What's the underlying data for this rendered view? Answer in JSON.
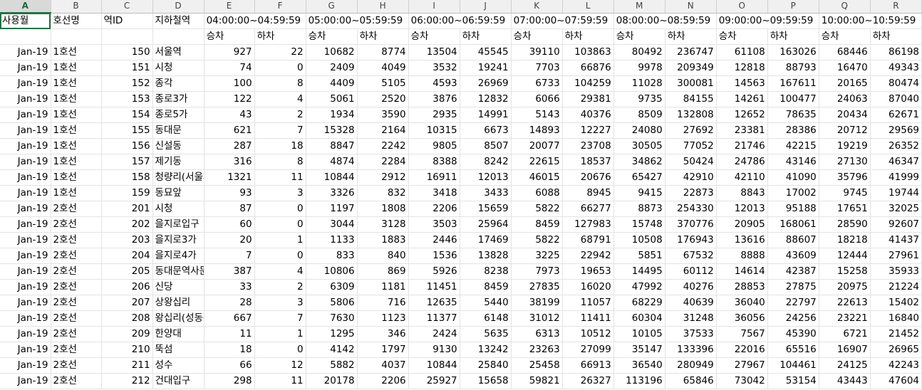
{
  "columns": [
    "A",
    "B",
    "C",
    "D",
    "E",
    "F",
    "G",
    "H",
    "I",
    "J",
    "K",
    "L",
    "M",
    "N",
    "O",
    "P",
    "Q",
    "R"
  ],
  "header_row1": {
    "A": "사용월",
    "B": "호선명",
    "C": "역ID",
    "D": "지하철역",
    "E": "04:00:00~04:59:59",
    "G": "05:00:00~05:59:59",
    "I": "06:00:00~06:59:59",
    "K": "07:00:00~07:59:59",
    "M": "08:00:00~08:59:59",
    "O": "09:00:00~09:59:59",
    "Q": "10:00:00~10:59:59"
  },
  "header_row2": {
    "E": "승차",
    "F": "하차",
    "G": "승차",
    "H": "하차",
    "I": "승차",
    "J": "하차",
    "K": "승차",
    "L": "하차",
    "M": "승차",
    "N": "하차",
    "O": "승차",
    "P": "하차",
    "Q": "승차",
    "R": "하차"
  },
  "rows": [
    [
      "Jan-19",
      "1호선",
      "150",
      "서울역",
      "927",
      "22",
      "10682",
      "8774",
      "13504",
      "45545",
      "39110",
      "103863",
      "80492",
      "236747",
      "61108",
      "163026",
      "68446",
      "86198"
    ],
    [
      "Jan-19",
      "1호선",
      "151",
      "시청",
      "74",
      "0",
      "2409",
      "4049",
      "3532",
      "19241",
      "7703",
      "66876",
      "9978",
      "209349",
      "12818",
      "88793",
      "16470",
      "49343"
    ],
    [
      "Jan-19",
      "1호선",
      "152",
      "종각",
      "100",
      "8",
      "4409",
      "5105",
      "4593",
      "26969",
      "6733",
      "104259",
      "11028",
      "300081",
      "14563",
      "167611",
      "20165",
      "80474"
    ],
    [
      "Jan-19",
      "1호선",
      "153",
      "종로3가",
      "122",
      "4",
      "5061",
      "2520",
      "3876",
      "12832",
      "6066",
      "29381",
      "9735",
      "84155",
      "14261",
      "100477",
      "24063",
      "87040"
    ],
    [
      "Jan-19",
      "1호선",
      "154",
      "종로5가",
      "43",
      "2",
      "1934",
      "3590",
      "2935",
      "14991",
      "5143",
      "40376",
      "8509",
      "132808",
      "12652",
      "78635",
      "20434",
      "62671"
    ],
    [
      "Jan-19",
      "1호선",
      "155",
      "동대문",
      "621",
      "7",
      "15328",
      "2164",
      "10315",
      "6673",
      "14893",
      "12227",
      "24080",
      "27692",
      "23381",
      "28386",
      "20712",
      "29569"
    ],
    [
      "Jan-19",
      "1호선",
      "156",
      "신설동",
      "287",
      "18",
      "8847",
      "2242",
      "9805",
      "8507",
      "20077",
      "23708",
      "30505",
      "77052",
      "21746",
      "42215",
      "19219",
      "26352"
    ],
    [
      "Jan-19",
      "1호선",
      "157",
      "제기동",
      "316",
      "8",
      "4874",
      "2284",
      "8388",
      "8242",
      "22615",
      "18537",
      "34862",
      "50424",
      "24786",
      "43146",
      "27130",
      "46347"
    ],
    [
      "Jan-19",
      "1호선",
      "158",
      "청량리(서울시립대입구)",
      "1321",
      "11",
      "10844",
      "2912",
      "16911",
      "12013",
      "46015",
      "20676",
      "65427",
      "42910",
      "42110",
      "41090",
      "35796",
      "41999"
    ],
    [
      "Jan-19",
      "1호선",
      "159",
      "동묘앞",
      "93",
      "3",
      "3326",
      "832",
      "3418",
      "3433",
      "6088",
      "8945",
      "9415",
      "22873",
      "8843",
      "17002",
      "9745",
      "19744"
    ],
    [
      "Jan-19",
      "2호선",
      "201",
      "시청",
      "87",
      "0",
      "1197",
      "1808",
      "2206",
      "15659",
      "5822",
      "66277",
      "8873",
      "254330",
      "12013",
      "95188",
      "17651",
      "32025"
    ],
    [
      "Jan-19",
      "2호선",
      "202",
      "을지로입구",
      "60",
      "0",
      "3044",
      "3128",
      "3503",
      "25964",
      "8459",
      "127983",
      "15748",
      "370776",
      "20905",
      "168061",
      "28590",
      "92607"
    ],
    [
      "Jan-19",
      "2호선",
      "203",
      "을지로3가",
      "20",
      "1",
      "1133",
      "1883",
      "2446",
      "17469",
      "5822",
      "68791",
      "10508",
      "176943",
      "13616",
      "88607",
      "18218",
      "41437"
    ],
    [
      "Jan-19",
      "2호선",
      "204",
      "을지로4가",
      "7",
      "0",
      "833",
      "840",
      "1536",
      "13828",
      "3225",
      "22942",
      "5851",
      "67532",
      "8888",
      "43609",
      "12444",
      "27961"
    ],
    [
      "Jan-19",
      "2호선",
      "205",
      "동대문역사문화공원",
      "387",
      "4",
      "10806",
      "869",
      "5926",
      "8238",
      "7973",
      "19653",
      "14495",
      "60112",
      "14614",
      "42387",
      "15258",
      "35933"
    ],
    [
      "Jan-19",
      "2호선",
      "206",
      "신당",
      "33",
      "2",
      "6309",
      "1181",
      "11451",
      "8459",
      "27835",
      "16020",
      "47992",
      "40276",
      "28853",
      "27875",
      "20975",
      "21224"
    ],
    [
      "Jan-19",
      "2호선",
      "207",
      "상왕십리",
      "28",
      "3",
      "5806",
      "716",
      "12635",
      "5440",
      "38199",
      "11057",
      "68229",
      "40639",
      "36040",
      "22797",
      "22613",
      "15402"
    ],
    [
      "Jan-19",
      "2호선",
      "208",
      "왕십리(성동구청)",
      "667",
      "7",
      "7630",
      "1123",
      "11377",
      "6148",
      "31012",
      "11411",
      "60304",
      "31248",
      "36056",
      "24256",
      "23221",
      "16840"
    ],
    [
      "Jan-19",
      "2호선",
      "209",
      "한양대",
      "11",
      "1",
      "1295",
      "346",
      "2424",
      "5635",
      "6313",
      "10512",
      "10105",
      "37533",
      "7567",
      "45390",
      "6721",
      "21452"
    ],
    [
      "Jan-19",
      "2호선",
      "210",
      "뚝섬",
      "18",
      "0",
      "4142",
      "1797",
      "9130",
      "13242",
      "23263",
      "27099",
      "35147",
      "133396",
      "22016",
      "65516",
      "16907",
      "26965"
    ],
    [
      "Jan-19",
      "2호선",
      "211",
      "성수",
      "66",
      "12",
      "5882",
      "4037",
      "10844",
      "25840",
      "25458",
      "66913",
      "36540",
      "280949",
      "27967",
      "104461",
      "24125",
      "42243"
    ],
    [
      "Jan-19",
      "2호선",
      "212",
      "건대입구",
      "298",
      "11",
      "20178",
      "2206",
      "25927",
      "15658",
      "59821",
      "26327",
      "113196",
      "65846",
      "73042",
      "53154",
      "43443",
      "47604"
    ]
  ],
  "selected_cell": "A1",
  "colors": {
    "accent": "#217346",
    "header_bg": "#f0f0f0",
    "gridline": "#e3e3e3"
  }
}
